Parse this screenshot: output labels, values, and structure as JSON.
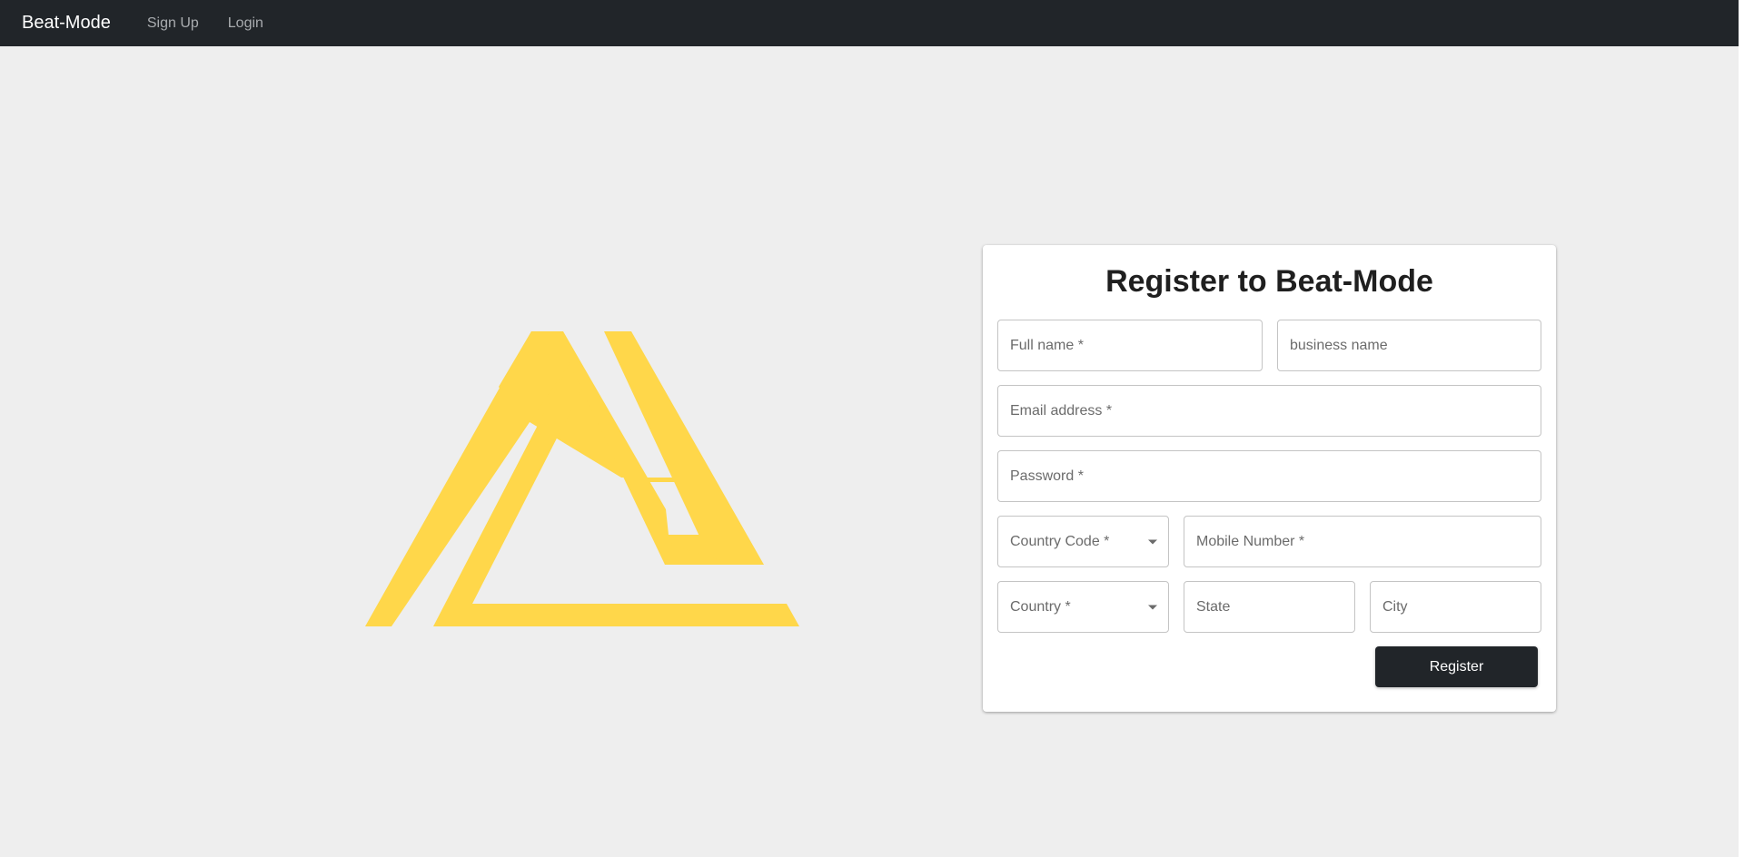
{
  "nav": {
    "brand": "Beat-Mode",
    "links": [
      "Sign Up",
      "Login"
    ]
  },
  "form": {
    "title": "Register to Beat-Mode",
    "full_name": "Full name *",
    "business_name": "business name",
    "email": "Email address *",
    "password": "Password *",
    "country_code": "Country Code *",
    "mobile_number": "Mobile Number *",
    "country": "Country *",
    "state": "State",
    "city": "City",
    "submit_label": "Register"
  },
  "colors": {
    "navbar": "#212529",
    "background": "#eeeeee",
    "logo": "#ffd74a",
    "button": "#212529"
  },
  "icons": {
    "logo": "triangle-logo",
    "dropdown": "caret-down-icon"
  }
}
